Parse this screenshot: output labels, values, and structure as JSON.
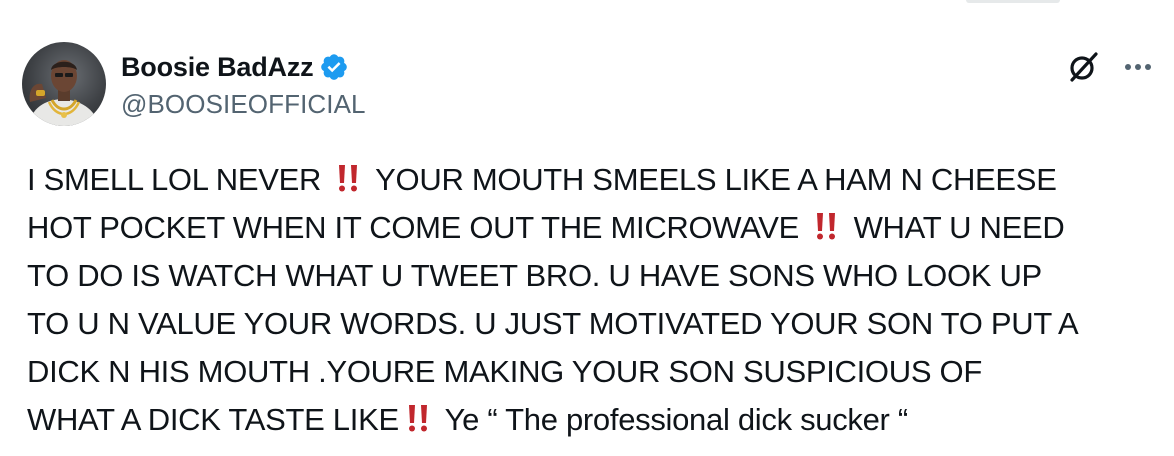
{
  "author": {
    "display_name": "Boosie BadAzz",
    "handle": "@BOOSIEOFFICIAL",
    "verified": true,
    "verified_color": "#1d9bf0"
  },
  "actions": {
    "grok_icon": "grok-icon",
    "more_icon": "more-icon"
  },
  "tweet": {
    "lines": [
      [
        "I SMELL LOL NEVER ",
        "bangbang",
        " YOUR MOUTH SMEELS LIKE A HAM N CHEESE"
      ],
      [
        "HOT POCKET WHEN IT COME OUT THE MICROWAVE ",
        "bangbang",
        " WHAT U NEED"
      ],
      [
        "TO DO IS WATCH WHAT U TWEET BRO. U HAVE  SONS WHO LOOK UP"
      ],
      [
        "TO U N VALUE YOUR WORDS. U JUST MOTIVATED YOUR SON TO PUT A"
      ],
      [
        "DICK N HIS MOUTH .YOURE MAKING YOUR SON  SUSPICIOUS OF"
      ],
      [
        "WHAT A DICK TASTE LIKE",
        "bangbang",
        " Ye “ The professional dick sucker “"
      ]
    ],
    "emoji_color": "#c1272d"
  },
  "colors": {
    "text": "#0f1419",
    "secondary": "#536471",
    "background": "#ffffff"
  }
}
